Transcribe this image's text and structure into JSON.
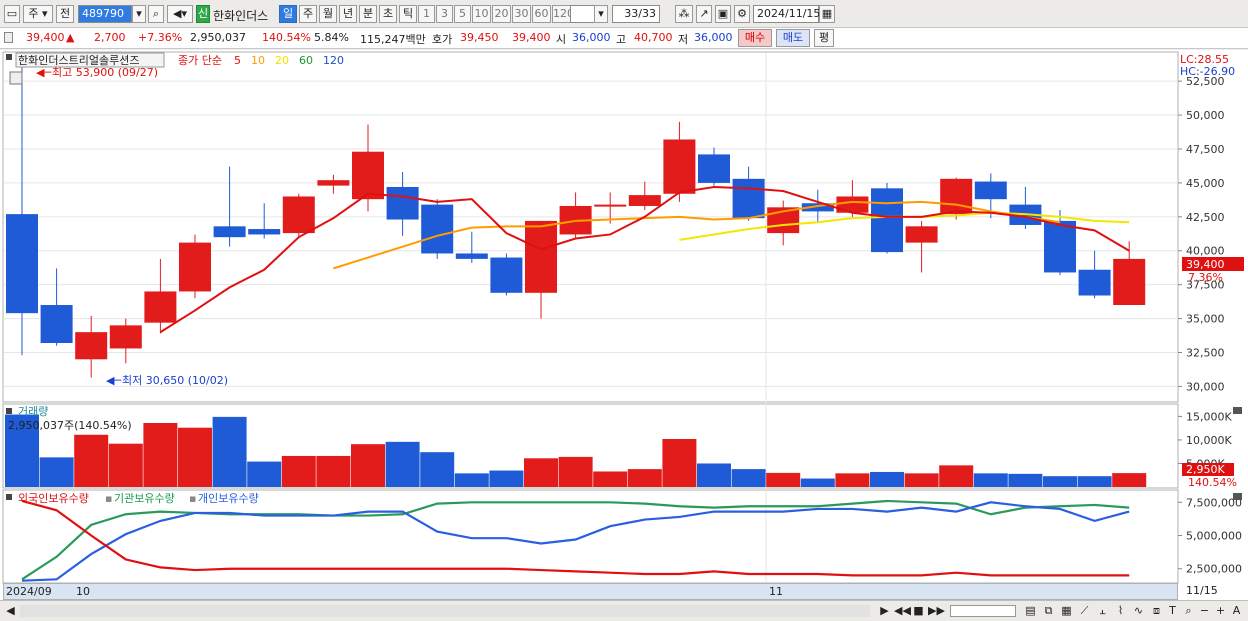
{
  "toolbar": {
    "b1": "주",
    "b2": "전",
    "code": "489790",
    "new_badge": "신",
    "stock_name": "한화인더스",
    "periods": [
      "일",
      "주",
      "월",
      "년",
      "분",
      "초",
      "틱"
    ],
    "numbers": [
      "1",
      "3",
      "5",
      "10",
      "20",
      "30",
      "60",
      "120"
    ],
    "count": "33/33",
    "date": "2024/11/15"
  },
  "quote": {
    "price": "39,400",
    "arrow": "▲",
    "change": "2,700",
    "change_pct": "+7.36%",
    "volume": "2,950,037",
    "vol_ratio": "140.54%",
    "turnover": "5.84%",
    "amount": "115,247백만",
    "ask_label": "호가",
    "ask1": "39,450",
    "bid1": "39,400",
    "open_label": "시",
    "open": "36,000",
    "high_label": "고",
    "high": "40,700",
    "low_label": "저",
    "low": "36,000",
    "buy": "매수",
    "sell": "매도",
    "avg": "평"
  },
  "chart": {
    "title": "한화인더스트리얼솔루션즈",
    "legend": {
      "label": "종가 단순",
      "ma": [
        "5",
        "10",
        "20",
        "60",
        "120"
      ],
      "ma_colors": [
        "#e01010",
        "#ff9c00",
        "#f4e000",
        "#1a9a30",
        "#1a50d0"
      ]
    },
    "max_label": "최고 53,900 (09/27)",
    "min_label": "최저 30,650 (10/02)",
    "lc": "LC:28.55",
    "hc": "HC:-26.90",
    "price_axis": [
      "52,500",
      "50,000",
      "47,500",
      "45,000",
      "42,500",
      "40,000",
      "37,500",
      "35,000",
      "32,500",
      "30,000"
    ],
    "last_price_tag": "39,400",
    "last_pct_tag": "7.36%",
    "volume_title": "거래량",
    "volume_info": "2,950,037주(140.54%)",
    "volume_axis": [
      "15,000K",
      "10,000K",
      "5,000K"
    ],
    "volume_tag": "2,950K",
    "volume_pct_tag": "140.54%",
    "holdings_legend": [
      {
        "label": "외국인보유수량",
        "color": "#e01010"
      },
      {
        "label": "기관보유수량",
        "color": "#1a9a50"
      },
      {
        "label": "개인보유수량",
        "color": "#2a5fe0"
      }
    ],
    "holdings_axis": [
      "7,500,000",
      "5,000,000",
      "2,500,000"
    ],
    "date_axis": {
      "left": "2024/09",
      "d1": "10",
      "d2": "11",
      "right": "11/15"
    }
  },
  "chart_data": {
    "type": "candlestick",
    "ohlc": [
      {
        "o": 42.7,
        "h": 53.9,
        "l": 32.3,
        "c": 35.4
      },
      {
        "o": 36.0,
        "h": 38.7,
        "l": 33.0,
        "c": 33.2
      },
      {
        "o": 32.0,
        "h": 35.2,
        "l": 30.65,
        "c": 34.0
      },
      {
        "o": 32.8,
        "h": 35.0,
        "l": 31.7,
        "c": 34.5
      },
      {
        "o": 34.7,
        "h": 39.4,
        "l": 33.9,
        "c": 37.0
      },
      {
        "o": 37.0,
        "h": 41.2,
        "l": 36.5,
        "c": 40.6
      },
      {
        "o": 41.8,
        "h": 46.2,
        "l": 40.3,
        "c": 41.0
      },
      {
        "o": 41.6,
        "h": 43.5,
        "l": 40.9,
        "c": 41.2
      },
      {
        "o": 41.3,
        "h": 44.2,
        "l": 41.0,
        "c": 44.0
      },
      {
        "o": 44.8,
        "h": 45.6,
        "l": 44.2,
        "c": 45.2
      },
      {
        "o": 43.8,
        "h": 49.3,
        "l": 42.9,
        "c": 47.3
      },
      {
        "o": 44.7,
        "h": 45.8,
        "l": 41.1,
        "c": 42.3
      },
      {
        "o": 43.4,
        "h": 43.8,
        "l": 39.4,
        "c": 39.8
      },
      {
        "o": 39.8,
        "h": 41.4,
        "l": 39.1,
        "c": 39.4
      },
      {
        "o": 39.5,
        "h": 39.8,
        "l": 36.7,
        "c": 36.9
      },
      {
        "o": 36.9,
        "h": 42.2,
        "l": 35.0,
        "c": 42.2
      },
      {
        "o": 41.2,
        "h": 44.3,
        "l": 40.9,
        "c": 43.3
      },
      {
        "o": 43.3,
        "h": 44.3,
        "l": 42.0,
        "c": 43.4
      },
      {
        "o": 43.3,
        "h": 45.1,
        "l": 43.0,
        "c": 44.1
      },
      {
        "o": 44.2,
        "h": 49.5,
        "l": 43.6,
        "c": 48.2
      },
      {
        "o": 47.1,
        "h": 47.6,
        "l": 44.8,
        "c": 45.0
      },
      {
        "o": 45.3,
        "h": 46.2,
        "l": 42.2,
        "c": 42.4
      },
      {
        "o": 41.3,
        "h": 43.7,
        "l": 40.4,
        "c": 43.2
      },
      {
        "o": 43.5,
        "h": 44.5,
        "l": 42.1,
        "c": 42.9
      },
      {
        "o": 42.8,
        "h": 45.2,
        "l": 42.5,
        "c": 44.0
      },
      {
        "o": 44.6,
        "h": 45.0,
        "l": 39.8,
        "c": 39.9
      },
      {
        "o": 40.6,
        "h": 42.2,
        "l": 38.4,
        "c": 41.8
      },
      {
        "o": 42.7,
        "h": 45.4,
        "l": 42.3,
        "c": 45.3
      },
      {
        "o": 45.1,
        "h": 45.7,
        "l": 42.4,
        "c": 43.8
      },
      {
        "o": 43.4,
        "h": 44.7,
        "l": 41.6,
        "c": 41.9
      },
      {
        "o": 42.2,
        "h": 43.0,
        "l": 38.2,
        "c": 38.4
      },
      {
        "o": 38.6,
        "h": 40.0,
        "l": 36.5,
        "c": 36.7
      },
      {
        "o": 36.0,
        "h": 40.7,
        "l": 36.0,
        "c": 39.4
      }
    ],
    "ma5": [
      null,
      null,
      null,
      null,
      34.0,
      35.6,
      37.3,
      38.6,
      41.0,
      42.4,
      44.2,
      44.0,
      43.6,
      43.8,
      41.3,
      40.1,
      40.9,
      41.2,
      42.5,
      44.3,
      44.7,
      44.6,
      44.4,
      43.6,
      42.8,
      42.5,
      42.5,
      42.9,
      42.8,
      42.5,
      41.9,
      41.5,
      40.0
    ],
    "ma10": [
      null,
      null,
      null,
      null,
      null,
      null,
      null,
      null,
      null,
      38.7,
      39.5,
      40.3,
      41.1,
      41.7,
      41.8,
      41.8,
      42.2,
      42.3,
      42.4,
      42.5,
      42.3,
      42.4,
      42.9,
      43.3,
      43.6,
      43.5,
      43.6,
      43.4,
      42.9,
      42.5,
      42.1
    ],
    "ma20": [
      null,
      null,
      null,
      null,
      null,
      null,
      null,
      null,
      null,
      null,
      null,
      null,
      null,
      null,
      null,
      null,
      null,
      null,
      null,
      40.8,
      41.2,
      41.6,
      41.9,
      42.1,
      42.4,
      42.5,
      42.5,
      42.6,
      42.8,
      42.7,
      42.5,
      42.2,
      42.1
    ],
    "volume_k": [
      15400,
      6300,
      11100,
      9200,
      13600,
      12600,
      14900,
      5400,
      6600,
      6600,
      9100,
      9600,
      7400,
      2900,
      3500,
      6100,
      6400,
      3300,
      3800,
      10200,
      5000,
      3800,
      3000,
      1800,
      2900,
      3200,
      2900,
      4600,
      2900,
      2800,
      2300,
      2300,
      2950
    ],
    "foreign_m": [
      7.6,
      6.9,
      5.0,
      3.2,
      2.6,
      2.4,
      2.5,
      2.5,
      2.5,
      2.5,
      2.5,
      2.5,
      2.5,
      2.5,
      2.5,
      2.4,
      2.3,
      2.2,
      2.1,
      2.1,
      2.3,
      2.1,
      2.1,
      2.1,
      2.0,
      2.0,
      2.0,
      2.2,
      2.0,
      2.0,
      2.0,
      2.0,
      2.0
    ],
    "inst_m": [
      1.7,
      3.4,
      5.8,
      6.6,
      6.8,
      6.7,
      6.6,
      6.6,
      6.6,
      6.5,
      6.5,
      6.6,
      7.4,
      7.5,
      7.5,
      7.5,
      7.5,
      7.5,
      7.4,
      7.2,
      7.1,
      7.2,
      7.2,
      7.2,
      7.4,
      7.6,
      7.5,
      7.4,
      6.6,
      7.1,
      7.2,
      7.3,
      7.1
    ],
    "indiv_m": [
      1.6,
      1.7,
      3.6,
      5.1,
      6.1,
      6.7,
      6.7,
      6.5,
      6.5,
      6.5,
      6.8,
      6.8,
      5.3,
      4.8,
      4.8,
      4.4,
      4.7,
      5.7,
      6.2,
      6.4,
      6.8,
      6.8,
      6.8,
      7.0,
      7.0,
      6.8,
      7.1,
      6.8,
      7.5,
      7.2,
      7.0,
      6.1,
      6.8
    ],
    "price_ylim": [
      29000,
      54500
    ],
    "volume_ylim": [
      0,
      17000
    ],
    "holdings_ylim": [
      1500000,
      8200000
    ]
  }
}
